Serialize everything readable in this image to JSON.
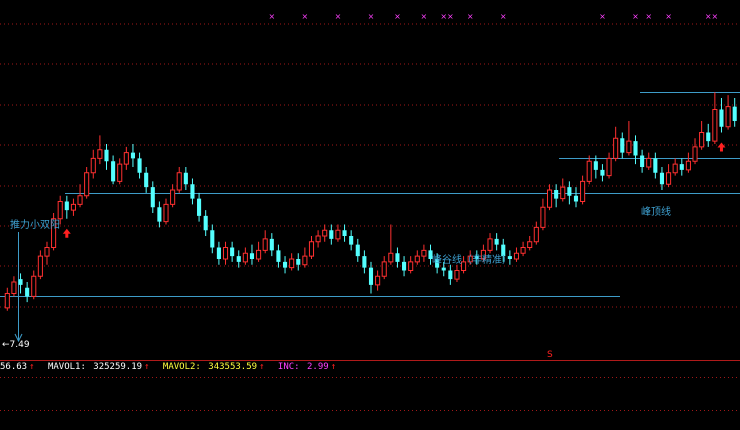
{
  "colors": {
    "background": "#000000",
    "up": "#ff3030",
    "down": "#54ffff",
    "grid": "#a01818",
    "support_line": "#3e9cc8",
    "marker": "#ff40ff",
    "annotation": "#3ea0d0",
    "mavol1": "#ffffff",
    "mavol2": "#ffff40",
    "inc": "#ff40ff",
    "signal_arrow": "#ff2020"
  },
  "annotations": {
    "left_label": "推力小双阳",
    "middle_label": "峰谷线（非精准）",
    "right_label": "峰顶线",
    "low_price_label": "7.49",
    "low_price_arrow": "←",
    "s_marker": "S"
  },
  "status_bar": {
    "vol_value": "56.63",
    "mavol1_label": "MAVOL1:",
    "mavol1_value": "325259.19",
    "mavol2_label": "MAVOL2:",
    "mavol2_value": "343553.59",
    "inc_label": "INC:",
    "inc_value": "2.99",
    "arrow": "↑"
  },
  "chart_data": {
    "type": "candlestick",
    "price_range": [
      7.3,
      8.5
    ],
    "candles": [
      [
        7.45,
        7.5,
        7.44,
        7.52
      ],
      [
        7.5,
        7.54,
        7.49,
        7.56
      ],
      [
        7.55,
        7.53,
        7.5,
        7.57
      ],
      [
        7.52,
        7.49,
        7.47,
        7.54
      ],
      [
        7.49,
        7.56,
        7.48,
        7.58
      ],
      [
        7.56,
        7.63,
        7.55,
        7.65
      ],
      [
        7.63,
        7.66,
        7.6,
        7.68
      ],
      [
        7.66,
        7.76,
        7.65,
        7.78
      ],
      [
        7.76,
        7.82,
        7.74,
        7.84
      ],
      [
        7.82,
        7.79,
        7.76,
        7.84
      ],
      [
        7.79,
        7.81,
        7.77,
        7.83
      ],
      [
        7.81,
        7.84,
        7.8,
        7.88
      ],
      [
        7.84,
        7.92,
        7.83,
        7.94
      ],
      [
        7.92,
        7.97,
        7.9,
        8.0
      ],
      [
        7.97,
        8.0,
        7.95,
        8.05
      ],
      [
        8.0,
        7.96,
        7.93,
        8.02
      ],
      [
        7.96,
        7.89,
        7.88,
        7.98
      ],
      [
        7.89,
        7.95,
        7.88,
        7.97
      ],
      [
        7.95,
        7.99,
        7.93,
        8.01
      ],
      [
        7.99,
        7.97,
        7.94,
        8.02
      ],
      [
        7.97,
        7.92,
        7.9,
        7.99
      ],
      [
        7.92,
        7.87,
        7.85,
        7.94
      ],
      [
        7.87,
        7.8,
        7.78,
        7.89
      ],
      [
        7.8,
        7.75,
        7.73,
        7.82
      ],
      [
        7.75,
        7.81,
        7.74,
        7.83
      ],
      [
        7.81,
        7.86,
        7.8,
        7.88
      ],
      [
        7.86,
        7.92,
        7.85,
        7.94
      ],
      [
        7.92,
        7.88,
        7.86,
        7.94
      ],
      [
        7.88,
        7.83,
        7.81,
        7.9
      ],
      [
        7.83,
        7.77,
        7.75,
        7.85
      ],
      [
        7.77,
        7.72,
        7.7,
        7.79
      ],
      [
        7.72,
        7.66,
        7.64,
        7.74
      ],
      [
        7.66,
        7.62,
        7.6,
        7.68
      ],
      [
        7.62,
        7.66,
        7.6,
        7.68
      ],
      [
        7.66,
        7.63,
        7.61,
        7.68
      ],
      [
        7.63,
        7.61,
        7.59,
        7.65
      ],
      [
        7.61,
        7.64,
        7.6,
        7.66
      ],
      [
        7.64,
        7.62,
        7.6,
        7.67
      ],
      [
        7.62,
        7.65,
        7.61,
        7.68
      ],
      [
        7.65,
        7.69,
        7.64,
        7.72
      ],
      [
        7.69,
        7.65,
        7.63,
        7.71
      ],
      [
        7.65,
        7.61,
        7.59,
        7.67
      ],
      [
        7.61,
        7.59,
        7.57,
        7.63
      ],
      [
        7.59,
        7.62,
        7.58,
        7.64
      ],
      [
        7.62,
        7.6,
        7.58,
        7.64
      ],
      [
        7.6,
        7.63,
        7.59,
        7.66
      ],
      [
        7.63,
        7.68,
        7.62,
        7.7
      ],
      [
        7.68,
        7.7,
        7.66,
        7.72
      ],
      [
        7.7,
        7.72,
        7.68,
        7.74
      ],
      [
        7.72,
        7.69,
        7.67,
        7.74
      ],
      [
        7.69,
        7.72,
        7.68,
        7.74
      ],
      [
        7.72,
        7.7,
        7.68,
        7.74
      ],
      [
        7.7,
        7.67,
        7.65,
        7.72
      ],
      [
        7.67,
        7.63,
        7.61,
        7.69
      ],
      [
        7.63,
        7.59,
        7.57,
        7.65
      ],
      [
        7.59,
        7.53,
        7.5,
        7.61
      ],
      [
        7.53,
        7.56,
        7.51,
        7.58
      ],
      [
        7.56,
        7.61,
        7.55,
        7.63
      ],
      [
        7.61,
        7.64,
        7.6,
        7.74
      ],
      [
        7.64,
        7.61,
        7.59,
        7.66
      ],
      [
        7.61,
        7.58,
        7.56,
        7.63
      ],
      [
        7.58,
        7.61,
        7.57,
        7.63
      ],
      [
        7.61,
        7.63,
        7.6,
        7.65
      ],
      [
        7.63,
        7.65,
        7.61,
        7.67
      ],
      [
        7.65,
        7.62,
        7.6,
        7.67
      ],
      [
        7.62,
        7.59,
        7.57,
        7.64
      ],
      [
        7.59,
        7.58,
        7.56,
        7.61
      ],
      [
        7.58,
        7.55,
        7.53,
        7.6
      ],
      [
        7.55,
        7.58,
        7.54,
        7.6
      ],
      [
        7.58,
        7.61,
        7.57,
        7.63
      ],
      [
        7.61,
        7.63,
        7.6,
        7.65
      ],
      [
        7.63,
        7.62,
        7.6,
        7.65
      ],
      [
        7.62,
        7.65,
        7.61,
        7.67
      ],
      [
        7.65,
        7.69,
        7.64,
        7.71
      ],
      [
        7.69,
        7.67,
        7.65,
        7.71
      ],
      [
        7.67,
        7.63,
        7.61,
        7.69
      ],
      [
        7.63,
        7.62,
        7.6,
        7.65
      ],
      [
        7.62,
        7.64,
        7.61,
        7.66
      ],
      [
        7.64,
        7.66,
        7.63,
        7.68
      ],
      [
        7.66,
        7.68,
        7.65,
        7.7
      ],
      [
        7.68,
        7.73,
        7.67,
        7.75
      ],
      [
        7.73,
        7.8,
        7.72,
        7.83
      ],
      [
        7.8,
        7.86,
        7.79,
        7.88
      ],
      [
        7.86,
        7.83,
        7.8,
        7.88
      ],
      [
        7.83,
        7.87,
        7.82,
        7.9
      ],
      [
        7.87,
        7.84,
        7.81,
        7.89
      ],
      [
        7.84,
        7.82,
        7.8,
        7.87
      ],
      [
        7.82,
        7.89,
        7.81,
        7.91
      ],
      [
        7.89,
        7.96,
        7.88,
        7.98
      ],
      [
        7.96,
        7.93,
        7.9,
        7.98
      ],
      [
        7.93,
        7.91,
        7.89,
        7.95
      ],
      [
        7.91,
        7.97,
        7.9,
        7.99
      ],
      [
        7.97,
        8.04,
        7.96,
        8.08
      ],
      [
        8.04,
        7.99,
        7.97,
        8.06
      ],
      [
        7.99,
        8.03,
        7.98,
        8.1
      ],
      [
        8.03,
        7.98,
        7.95,
        8.05
      ],
      [
        7.98,
        7.94,
        7.92,
        8.0
      ],
      [
        7.94,
        7.97,
        7.93,
        7.99
      ],
      [
        7.97,
        7.92,
        7.9,
        7.99
      ],
      [
        7.92,
        7.88,
        7.86,
        7.94
      ],
      [
        7.88,
        7.92,
        7.87,
        7.95
      ],
      [
        7.92,
        7.95,
        7.91,
        7.97
      ],
      [
        7.95,
        7.93,
        7.91,
        7.97
      ],
      [
        7.93,
        7.96,
        7.92,
        7.99
      ],
      [
        7.96,
        8.01,
        7.95,
        8.04
      ],
      [
        8.01,
        8.06,
        8.0,
        8.1
      ],
      [
        8.06,
        8.03,
        8.01,
        8.09
      ],
      [
        8.03,
        8.14,
        8.02,
        8.2
      ],
      [
        8.14,
        8.08,
        8.06,
        8.18
      ],
      [
        8.08,
        8.15,
        8.07,
        8.19
      ],
      [
        8.15,
        8.1,
        8.08,
        8.18
      ]
    ],
    "support_line": 7.49,
    "valley_line": 7.85,
    "middle_line": 7.97,
    "peak_line": 8.2,
    "peak_line_start_index": 109,
    "middle_line_start_index": 91,
    "signal_arrows_at": [
      9,
      108
    ],
    "top_marker_indices": [
      40,
      45,
      50,
      55,
      59,
      63,
      66,
      67,
      70,
      75,
      90,
      95,
      97,
      100,
      106,
      107
    ],
    "grid_rows": 7
  }
}
